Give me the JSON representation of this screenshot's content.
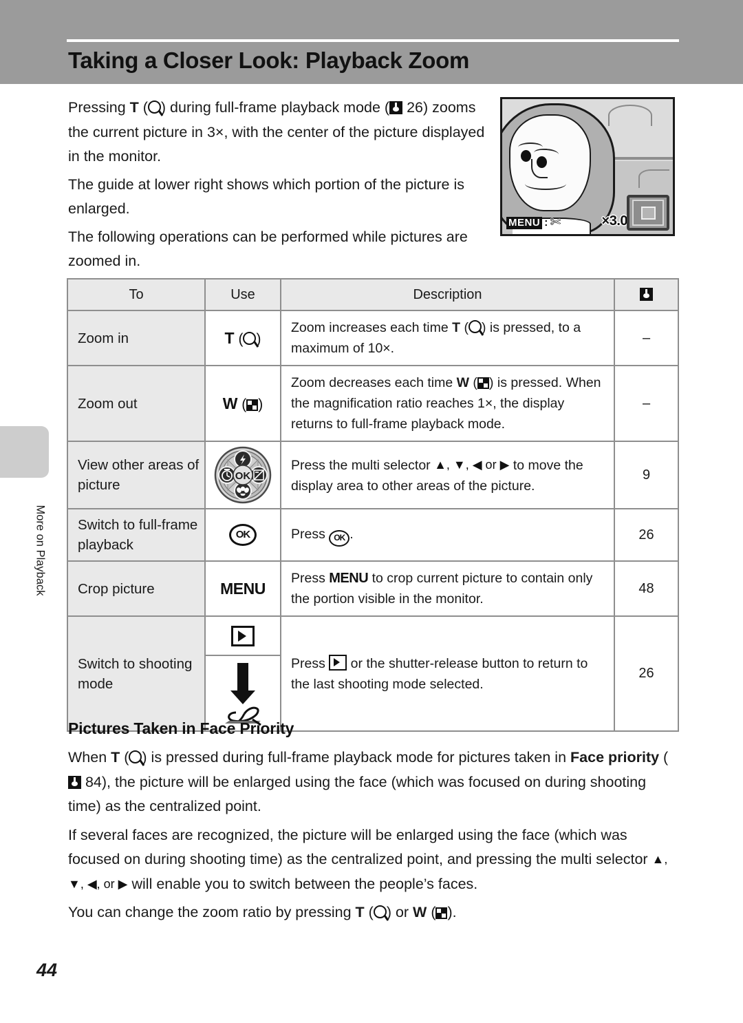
{
  "header": {
    "title": "Taking a Closer Look: Playback Zoom",
    "band_color": "#9b9b9b"
  },
  "side_tab": {
    "label": "More on Playback",
    "tab_color": "#cdcdcd"
  },
  "intro": {
    "p1_a": "Pressing ",
    "p1_t": "T",
    "p1_b": " (",
    "p1_c": ") during full-frame playback mode (",
    "p1_page": " 26) zooms the current picture in 3×, with the center of the picture displayed in the monitor.",
    "p2": "The guide at lower right shows which portion of the picture is enlarged.",
    "p3": "The following operations can be performed while pictures are zoomed in."
  },
  "monitor": {
    "menu_label": "MENU",
    "menu_colon": ":",
    "scissors_icon": "scissors-icon",
    "zoom_ratio": "×3.0",
    "guide_icon": "zoom-guide-icon"
  },
  "table": {
    "headers": {
      "to": "To",
      "use": "Use",
      "description": "Description",
      "reference": "book-icon"
    },
    "rows": [
      {
        "to": "Zoom in",
        "use_button": "T",
        "use_icon": "magnify-icon",
        "desc_a": "Zoom increases each time ",
        "desc_btn": "T",
        "desc_icon": "magnify-icon",
        "desc_b": " is pressed, to a maximum of 10×.",
        "ref": "–"
      },
      {
        "to": "Zoom out",
        "use_button": "W",
        "use_icon": "thumbnail-icon",
        "desc_a": "Zoom decreases each time ",
        "desc_btn": "W",
        "desc_icon": "thumbnail-icon",
        "desc_b": " is pressed. When the magnification ratio reaches 1×, the display returns to full-frame playback mode.",
        "ref": "–"
      },
      {
        "to": "View other areas of picture",
        "use_icon": "multi-selector-icon",
        "desc_a": "Press the multi selector ",
        "desc_arrows": "▲, ▼, ◀ or ▶",
        "desc_b": " to move the display area to other areas of the picture.",
        "ref": "9"
      },
      {
        "to": "Switch to full-frame playback",
        "use_icon": "ok-button-icon",
        "use_label": "OK",
        "desc_a": "Press ",
        "desc_btn_label": "OK",
        "desc_b": ".",
        "ref": "26"
      },
      {
        "to": "Crop picture",
        "use_label": "MENU",
        "desc_a": "Press ",
        "desc_btn_label": "MENU",
        "desc_b": " to crop current picture to contain only the portion visible in the monitor.",
        "ref": "48"
      },
      {
        "to": "Switch to shooting mode",
        "use_icon_top": "playback-button-icon",
        "use_icon_arrow": "down-arrow-icon",
        "use_icon_bottom": "shutter-release-finger-icon",
        "desc_a": "Press ",
        "desc_btn_icon": "playback-button-icon",
        "desc_b": " or the shutter-release button to return to the last shooting mode selected.",
        "ref": "26"
      }
    ]
  },
  "face_priority": {
    "title": "Pictures Taken in Face Priority",
    "p1_a": "When ",
    "p1_t": "T",
    "p1_b": " (",
    "p1_c": ") is pressed during full-frame playback mode for pictures taken in ",
    "p1_bold1": "Face priority",
    "p1_d": " (",
    "p1_page": " 84), the picture will be enlarged using the face (which was focused on during shooting time) as the centralized point.",
    "p2_a": "If several faces are recognized, the picture will be enlarged using the face (which was focused on during shooting time) as the centralized point, and pressing the multi selector ",
    "p2_arrows": "▲, ▼, ◀, or ▶",
    "p2_b": " will enable you to switch between the people’s faces.",
    "p3_a": "You can change the zoom ratio by pressing ",
    "p3_t": "T",
    "p3_b": " (",
    "p3_c": ") or ",
    "p3_w": "W",
    "p3_d": " (",
    "p3_e": ")."
  },
  "footer": {
    "page_number": "44"
  }
}
